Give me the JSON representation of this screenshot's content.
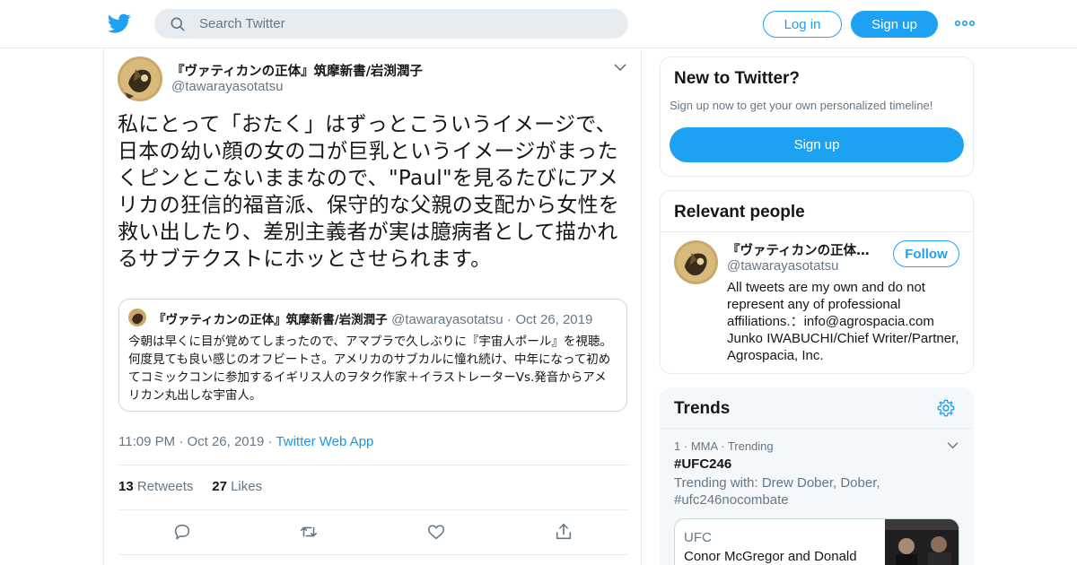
{
  "header": {
    "search_placeholder": "Search Twitter",
    "login_label": "Log in",
    "signup_label": "Sign up",
    "brand_color": "#1da1f2"
  },
  "tweet": {
    "author_name": "『ヴァティカンの正体』筑摩新書/岩渕潤子",
    "author_handle": "@tawarayasotatsu",
    "text": "私にとって「おたく」はずっとこういうイメージで、日本の幼い顔の女のコが巨乳というイメージがまったくピンとこないままなので、\"Paul\"を見るたびにアメリカの狂信的福音派、保守的な父親の支配から女性を救い出したり、差別主義者が実は臆病者として描かれるサブテクストにホッとさせられます。",
    "quote": {
      "author_name": "『ヴァティカンの正体』筑摩新書/岩渕潤子",
      "author_handle": "@tawarayasotatsu",
      "separator": "·",
      "date": "Oct 26, 2019",
      "text": "今朝は早くに目が覚めてしまったので、アマプラで久しぶりに『宇宙人ポール』を視聴。何度見ても良い感じのオフビートさ。アメリカのサブカルに憧れ続け、中年になって初めてコミックコンに参加するイギリス人のヲタク作家＋イラストレーターVs.発音からアメリカン丸出しな宇宙人。"
    },
    "time": "11:09 PM",
    "separator": "·",
    "date": "Oct 26, 2019",
    "app": "Twitter Web App",
    "retweets_count": "13",
    "retweets_label": "Retweets",
    "likes_count": "27",
    "likes_label": "Likes"
  },
  "new_to_twitter": {
    "title": "New to Twitter?",
    "subtitle": "Sign up now to get your own personalized timeline!",
    "signup_label": "Sign up"
  },
  "relevant_people": {
    "title": "Relevant people",
    "name": "『ヴァティカンの正体…",
    "handle": "@tawarayasotatsu",
    "follow_label": "Follow",
    "bio": "All tweets are my own and do not represent any of professional affiliations.：info@agrospacia.com Junko IWABUCHI/Chief Writer/Partner, Agrospacia, Inc."
  },
  "trends": {
    "title": "Trends",
    "items": [
      {
        "rank": "1",
        "separator": "·",
        "category": "MMA",
        "separator2": "·",
        "status": "Trending",
        "tag": "#UFC246",
        "trending_with": "Trending with: Drew Dober, Dober, #ufc246nocombate",
        "card_category": "UFC",
        "card_headline": "Conor McGregor and Donald"
      }
    ]
  }
}
